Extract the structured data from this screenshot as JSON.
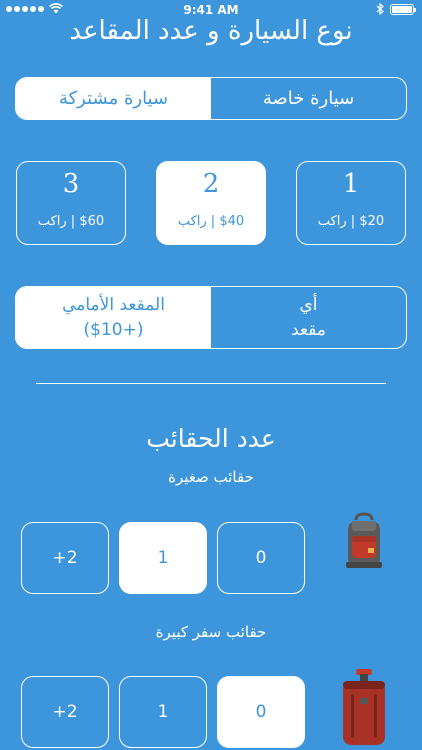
{
  "status_bar": {
    "carrier_dots": 5,
    "time": "9:41 AM",
    "battery_level": 1.0
  },
  "title": "نوع السيارة و عدد المقاعد",
  "car_type": {
    "options": [
      "سيارة خاصة",
      "سيارة مشتركة"
    ],
    "selected": "سيارة مشتركة"
  },
  "seats": [
    {
      "number": "1",
      "price": "$20 | راكب"
    },
    {
      "number": "2",
      "price": "$40 | راكب"
    },
    {
      "number": "3",
      "price": "$60 | راكب"
    }
  ],
  "seats_selected": "2",
  "seat_choice": {
    "any_line1": "أي",
    "any_line2": "مقعد",
    "front_line1": "المقعد الأمامي",
    "front_line2": "(+$10)",
    "selected": "front"
  },
  "bags": {
    "title": "عدد الحقائب",
    "small": {
      "label": "حقائب صغيرة",
      "options": [
        "0",
        "1",
        "+2"
      ],
      "selected": "1",
      "icon": "backpack-icon"
    },
    "large": {
      "label": "حقائب سفر كبيرة",
      "options": [
        "0",
        "1",
        "+2"
      ],
      "selected": "0",
      "icon": "suitcase-icon"
    }
  },
  "colors": {
    "background": "#3d96dc",
    "active_background": "#ffffff",
    "active_text": "#3d96dc"
  }
}
